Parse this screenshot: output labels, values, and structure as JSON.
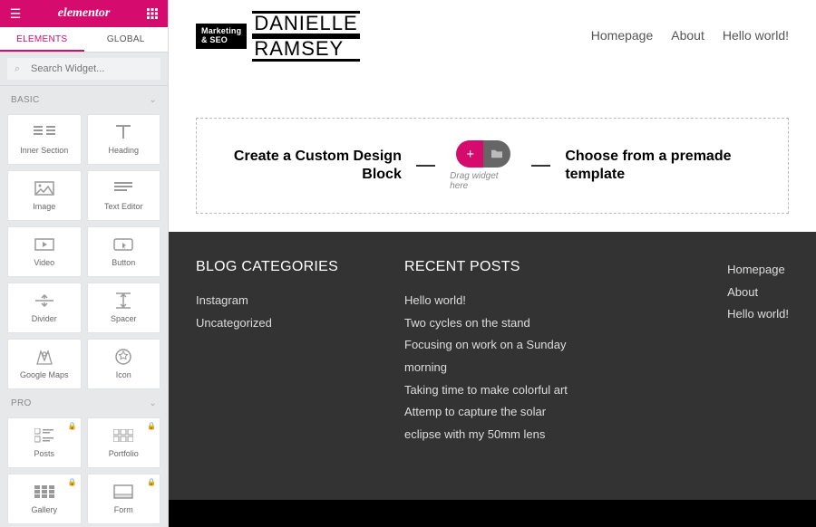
{
  "app": {
    "brand": "elementor"
  },
  "tabs": {
    "elements": "ELEMENTS",
    "global": "GLOBAL"
  },
  "search": {
    "placeholder": "Search Widget..."
  },
  "sections": {
    "basic": "BASIC",
    "pro": "PRO"
  },
  "widgets": {
    "basic": [
      {
        "label": "Inner Section",
        "icon": "inner-section"
      },
      {
        "label": "Heading",
        "icon": "heading"
      },
      {
        "label": "Image",
        "icon": "image"
      },
      {
        "label": "Text Editor",
        "icon": "text-editor"
      },
      {
        "label": "Video",
        "icon": "video"
      },
      {
        "label": "Button",
        "icon": "button"
      },
      {
        "label": "Divider",
        "icon": "divider"
      },
      {
        "label": "Spacer",
        "icon": "spacer"
      },
      {
        "label": "Google Maps",
        "icon": "google-maps"
      },
      {
        "label": "Icon",
        "icon": "icon"
      }
    ],
    "pro": [
      {
        "label": "Posts",
        "icon": "posts",
        "locked": true
      },
      {
        "label": "Portfolio",
        "icon": "portfolio",
        "locked": true
      },
      {
        "label": "Gallery",
        "icon": "gallery",
        "locked": true
      },
      {
        "label": "Form",
        "icon": "form",
        "locked": true
      }
    ]
  },
  "site": {
    "logo_badge_line1": "Marketing",
    "logo_badge_line2": "& SEO",
    "logo_name_line1": "DANIELLE",
    "logo_name_line2": "RAMSEY",
    "nav": [
      "Homepage",
      "About",
      "Hello world!"
    ]
  },
  "dropzone": {
    "left_text": "Create a Custom Design Block",
    "right_text": "Choose from a premade template",
    "hint": "Drag widget here"
  },
  "footer": {
    "cats_title": "BLOG CATEGORIES",
    "cats": [
      "Instagram",
      "Uncategorized"
    ],
    "posts_title": "RECENT POSTS",
    "posts": [
      "Hello world!",
      "Two cycles on the stand",
      "Focusing on work on a Sunday morning",
      "Taking time to make colorful art",
      "Attemp to capture the solar eclipse with my 50mm lens"
    ],
    "nav": [
      "Homepage",
      "About",
      "Hello world!"
    ]
  }
}
